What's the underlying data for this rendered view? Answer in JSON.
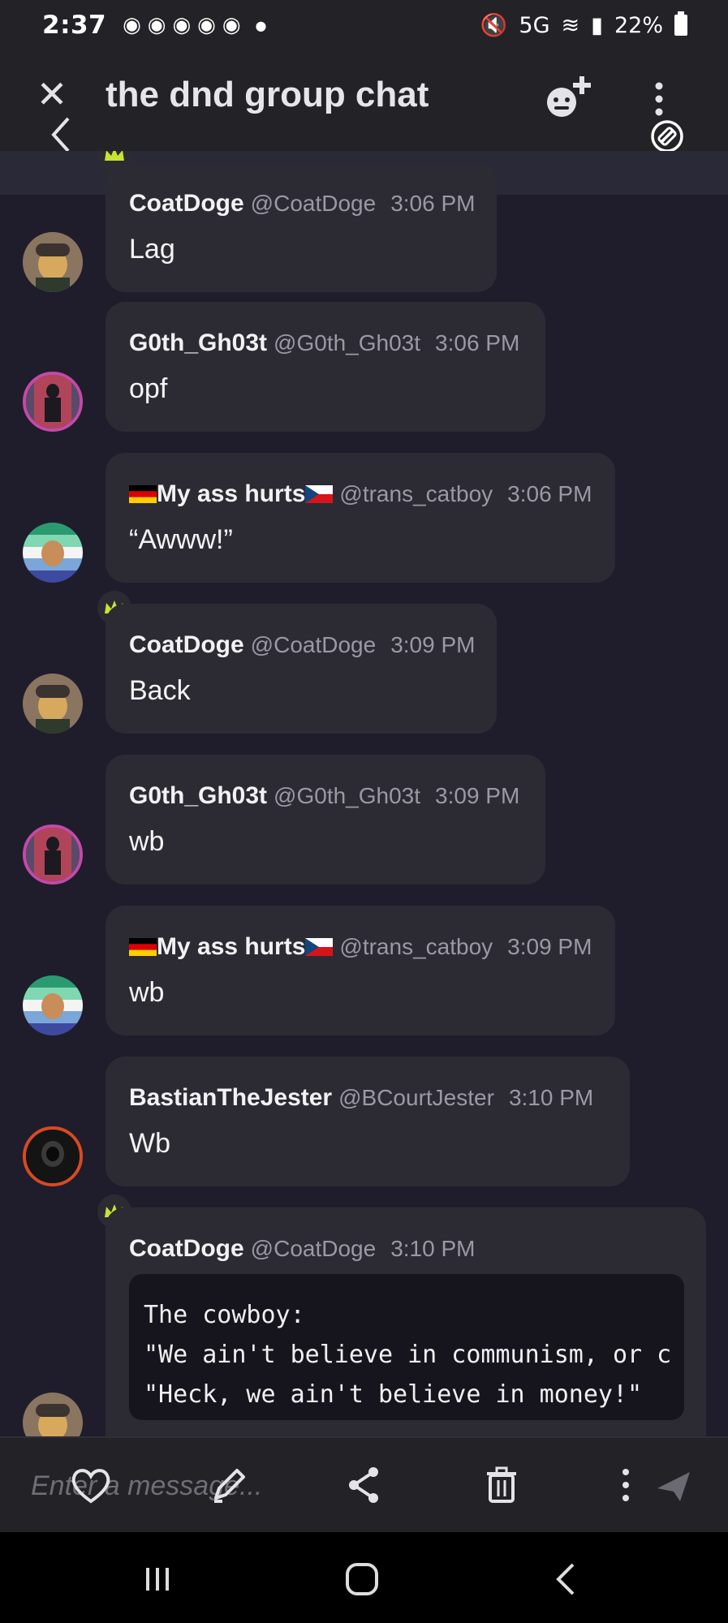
{
  "status_bar": {
    "time": "2:37",
    "network": "5G",
    "battery": "22%"
  },
  "header": {
    "title": "the dnd group chat"
  },
  "messages": [
    {
      "name": "CoatDoge",
      "handle": "@CoatDoge",
      "time": "3:06 PM",
      "text": "Lag",
      "crown": true,
      "avatar": "coatdoge"
    },
    {
      "name": "G0th_Gh03t",
      "handle": "@G0th_Gh03t",
      "time": "3:06 PM",
      "text": "opf",
      "crown": false,
      "avatar": "goth"
    },
    {
      "name": "My ass hurts",
      "handle": "@trans_catboy",
      "time": "3:06 PM",
      "text": "“Awww!”",
      "crown": false,
      "avatar": "catboy"
    },
    {
      "name": "CoatDoge",
      "handle": "@CoatDoge",
      "time": "3:09 PM",
      "text": "Back",
      "crown": true,
      "avatar": "coatdoge"
    },
    {
      "name": "G0th_Gh03t",
      "handle": "@G0th_Gh03t",
      "time": "3:09 PM",
      "text": "wb",
      "crown": false,
      "avatar": "goth"
    },
    {
      "name": "My ass hurts",
      "handle": "@trans_catboy",
      "time": "3:09 PM",
      "text": "wb",
      "crown": false,
      "avatar": "catboy"
    },
    {
      "name": "BastianTheJester",
      "handle": "@BCourtJester",
      "time": "3:10 PM",
      "text": "Wb",
      "crown": false,
      "avatar": "jester"
    },
    {
      "name": "CoatDoge",
      "handle": "@CoatDoge",
      "time": "3:10 PM",
      "code": "The cowboy:\n\"We ain't believe in communism, or c\n\"Heck, we ain't believe in money!\"",
      "crown": true,
      "avatar": "coatdoge"
    }
  ],
  "composer": {
    "placeholder": "Enter a message..."
  },
  "colors": {
    "background": "#1f1d2b",
    "bubble": "#2c2b33",
    "crown": "#c6e432",
    "header": "#232226"
  }
}
